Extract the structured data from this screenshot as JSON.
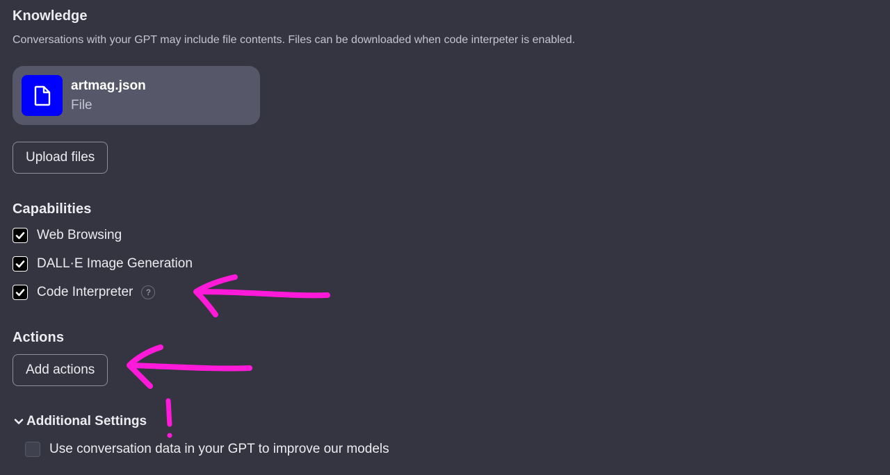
{
  "knowledge": {
    "title": "Knowledge",
    "description": "Conversations with your GPT may include file contents. Files can be downloaded when code interpeter is enabled.",
    "file": {
      "name": "artmag.json",
      "type": "File",
      "icon": "file-icon",
      "icon_bg": "#0000ff"
    },
    "upload_label": "Upload files"
  },
  "capabilities": {
    "title": "Capabilities",
    "items": [
      {
        "label": "Web Browsing",
        "checked": true
      },
      {
        "label": "DALL·E Image Generation",
        "checked": true
      },
      {
        "label": "Code Interpreter",
        "checked": true,
        "help": "?"
      }
    ]
  },
  "actions": {
    "title": "Actions",
    "add_label": "Add actions"
  },
  "additional_settings": {
    "title": "Additional Settings",
    "icon": "chevron-down-icon",
    "expanded": true,
    "option": {
      "label": "Use conversation data in your GPT to improve our models",
      "checked": false
    }
  },
  "annotations": {
    "color": "#ff1ad9",
    "exclamation": "!"
  }
}
